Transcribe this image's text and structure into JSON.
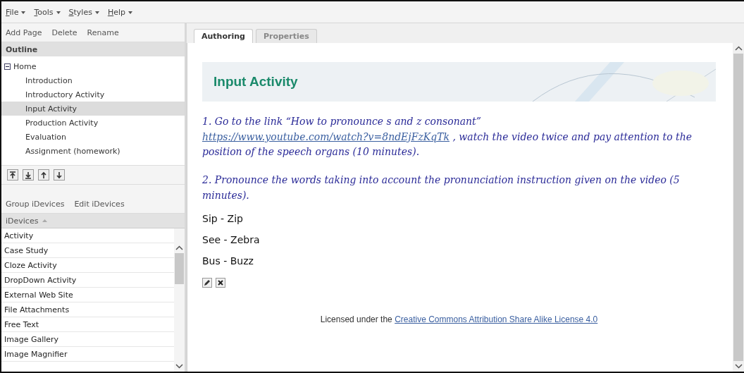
{
  "menu": [
    "File",
    "Tools",
    "Styles",
    "Help"
  ],
  "outline_toolbar": [
    "Add Page",
    "Delete",
    "Rename"
  ],
  "outline": {
    "title": "Outline",
    "tree": [
      {
        "label": "Home",
        "expanded": true,
        "selected": false,
        "children": [
          {
            "label": "Introduction",
            "selected": false
          },
          {
            "label": "Introductory Activity",
            "selected": false
          },
          {
            "label": "Input Activity",
            "selected": true
          },
          {
            "label": "Production Activity",
            "selected": false
          },
          {
            "label": "Evaluation",
            "selected": false
          },
          {
            "label": "Assignment (homework)",
            "selected": false
          }
        ]
      }
    ]
  },
  "idevice_toolbar": [
    "Group iDevices",
    "Edit iDevices"
  ],
  "idevices": {
    "column": "iDevices",
    "items": [
      "Activity",
      "Case Study",
      "Cloze Activity",
      "DropDown Activity",
      "External Web Site",
      "File Attachments",
      "Free Text",
      "Image Gallery",
      "Image Magnifier"
    ]
  },
  "tabs": [
    {
      "label": "Authoring",
      "selected": true
    },
    {
      "label": "Properties",
      "selected": false
    }
  ],
  "page": {
    "heading": "Input Activity",
    "instructions": [
      {
        "before": "1. Go to the link “How to pronounce s and z consonant” ",
        "link": "https://www.youtube.com/watch?v=8ndEjFzKqTk",
        "after": " , watch the video twice and pay attention to the position of the speech organs (10 minutes)."
      },
      {
        "before": "2. Pronounce the words taking into account the pronunciation instruction given on the video (5 minutes)."
      }
    ],
    "words": [
      "Sip - Zip",
      "See - Zebra",
      "Bus - Buzz"
    ],
    "license": {
      "text": "Licensed under the ",
      "link": "Creative Commons Attribution Share Alike License 4.0"
    }
  }
}
